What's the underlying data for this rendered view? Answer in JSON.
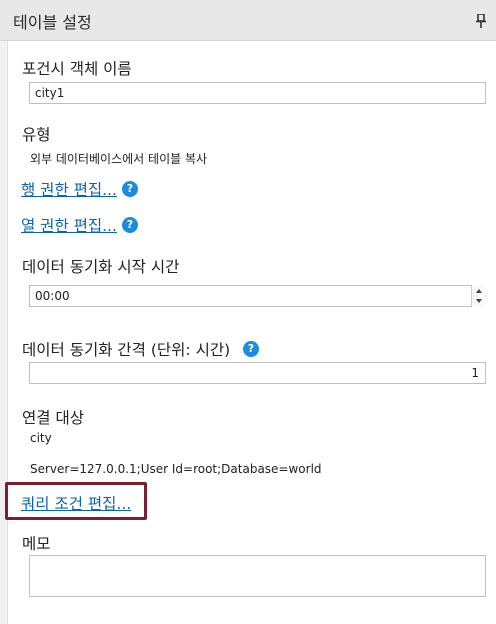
{
  "header": {
    "title": "테이블 설정",
    "pin_icon": "pin-icon"
  },
  "object_name": {
    "label": "포건시 객체 이름",
    "value": "city1"
  },
  "type": {
    "label": "유형",
    "value": "외부 데이터베이스에서 테이블 복사"
  },
  "links": {
    "row_permissions": "행 권한 편집...",
    "column_permissions": "열 권한 편집...",
    "query_conditions": "쿼리 조건 편집..."
  },
  "sync_start": {
    "label": "데이터 동기화 시작 시간",
    "value": "00:00"
  },
  "sync_interval": {
    "label": "데이터 동기화 간격 (단위: 시간)",
    "value": "1"
  },
  "connection": {
    "label": "연결 대상",
    "target": "city",
    "connection_string": "Server=127.0.0.1;User Id=root;Database=world"
  },
  "memo": {
    "label": "메모",
    "value": ""
  },
  "colors": {
    "link": "#0a63b0",
    "help_icon": "#1d8cdc",
    "highlight_border": "#7a1f2e"
  }
}
